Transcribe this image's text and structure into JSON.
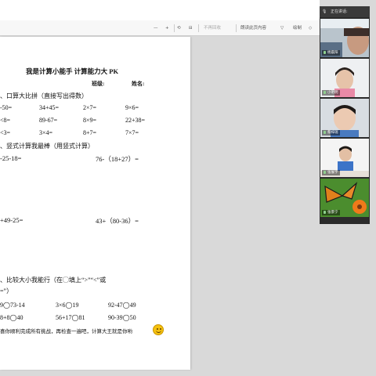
{
  "toolbar": {
    "minus": "—",
    "plus": "+",
    "rotate": "⟲",
    "print": "不再回收",
    "read_aloud": "朗读此页内容",
    "draw": "绘制",
    "highlight": "▽",
    "erase": "◇"
  },
  "doc": {
    "title": "我是计算小能手 计算能力大 PK",
    "class_label": "班级:",
    "name_label": "姓名:",
    "sec1": "、口算大比拼（直接写出得数）",
    "r1": [
      "-50=",
      "34+45=",
      "2×7=",
      "9×6="
    ],
    "r2": [
      "<8=",
      "89-67=",
      "8×9=",
      "22+38="
    ],
    "r3": [
      "<3=",
      "3×4=",
      "8+7=",
      "7×7="
    ],
    "sec2": "、竖式计算我最棒（用竖式计算）",
    "v1": [
      "-25-18=",
      "76-（18+27）="
    ],
    "v2": [
      "+49-25=",
      "43+（80-36）="
    ],
    "sec3": "、比较大小我能行（在◯填上“>”“<”或",
    "sec3b": "=”）",
    "c1": [
      "9◯73-14",
      "3×6◯19",
      "92-47◯49"
    ],
    "c2": [
      "8+8◯40",
      "56+17◯81",
      "90-39◯50"
    ],
    "closing": "喜你顺利完成所有挑战，再检查一遍吧，计算大王就是你哟"
  },
  "meeting": {
    "header": "正在讲话:",
    "participants": [
      {
        "name": "杨晨阳"
      },
      {
        "name": "小明明"
      },
      {
        "name": "蔡梓瑞"
      },
      {
        "name": "张展宇"
      },
      {
        "name": "张景宁"
      }
    ]
  },
  "colors": {
    "panel_bg": "#2b2b2b",
    "smile": "#f6c20f",
    "page_bg": "#ffffff"
  }
}
